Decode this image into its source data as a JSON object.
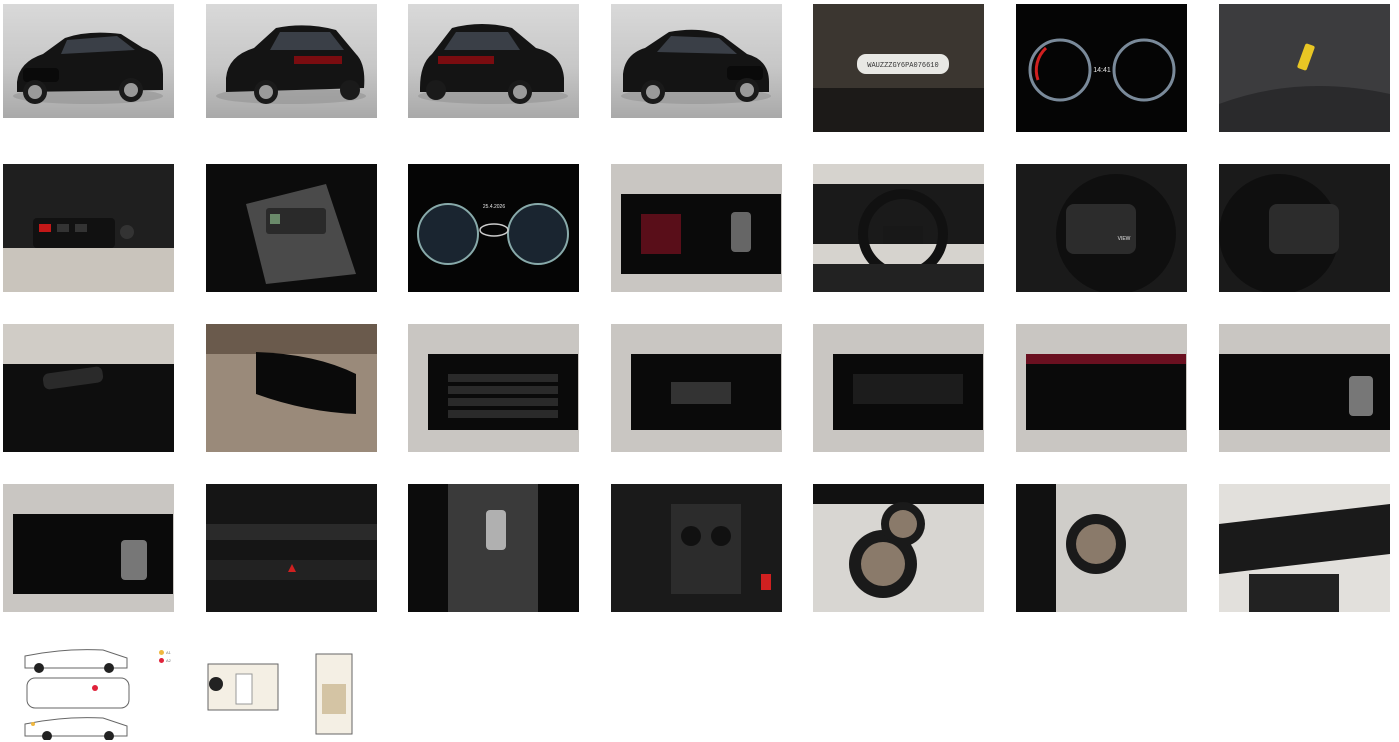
{
  "gallery": {
    "images": [
      {
        "name": "exterior-front-left",
        "kind": "studio"
      },
      {
        "name": "exterior-rear-left",
        "kind": "studio"
      },
      {
        "name": "exterior-rear-right",
        "kind": "studio"
      },
      {
        "name": "exterior-front-right",
        "kind": "studio"
      },
      {
        "name": "windshield-vin-plate",
        "kind": "photo",
        "text": "WAUZZZGY6PA076610"
      },
      {
        "name": "instrument-cluster-digital",
        "kind": "photo",
        "time": "14:41"
      },
      {
        "name": "key-tag-on-seat",
        "kind": "photo"
      },
      {
        "name": "door-window-switches",
        "kind": "photo"
      },
      {
        "name": "center-console-buttons",
        "kind": "photo"
      },
      {
        "name": "instrument-cluster-parked",
        "kind": "photo",
        "date": "25.4.2026"
      },
      {
        "name": "infotainment-parking-sensors",
        "kind": "photo"
      },
      {
        "name": "steering-wheel-cockpit",
        "kind": "photo"
      },
      {
        "name": "steering-wheel-left-controls",
        "kind": "photo",
        "text": "VIEW"
      },
      {
        "name": "steering-wheel-right-controls",
        "kind": "photo"
      },
      {
        "name": "wiper-stalk",
        "kind": "photo"
      },
      {
        "name": "rearview-mirror",
        "kind": "photo"
      },
      {
        "name": "infotainment-radio",
        "kind": "photo"
      },
      {
        "name": "infotainment-phone-connect",
        "kind": "photo"
      },
      {
        "name": "infotainment-apple-carplay",
        "kind": "photo"
      },
      {
        "name": "infotainment-service-intervals",
        "kind": "photo"
      },
      {
        "name": "infotainment-driver-assist",
        "kind": "photo"
      },
      {
        "name": "infotainment-driver-assist-2",
        "kind": "photo"
      },
      {
        "name": "climate-controls",
        "kind": "photo"
      },
      {
        "name": "gear-selector",
        "kind": "photo"
      },
      {
        "name": "cupholders-console",
        "kind": "photo"
      },
      {
        "name": "trunk-with-wheels",
        "kind": "photo"
      },
      {
        "name": "rear-seat-with-wheels",
        "kind": "photo"
      },
      {
        "name": "dashboard-interior-view",
        "kind": "photo"
      },
      {
        "name": "damage-diagram-exterior",
        "kind": "diagram"
      },
      {
        "name": "damage-diagram-interior",
        "kind": "diagram"
      }
    ],
    "legend": {
      "items": [
        {
          "label": "A1",
          "color": "#f0b840"
        },
        {
          "label": "A2",
          "color": "#e0223a"
        }
      ]
    }
  }
}
